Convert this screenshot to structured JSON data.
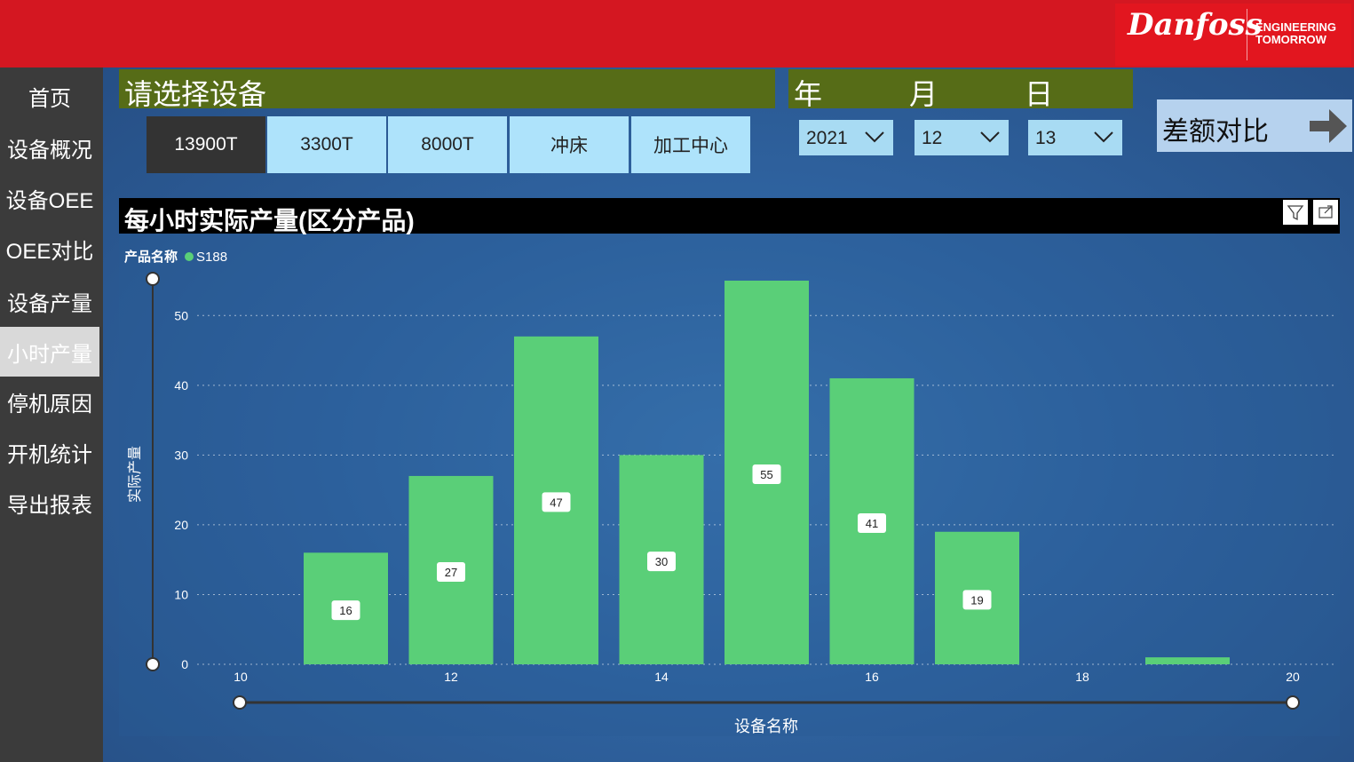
{
  "header": {
    "brand": "Danfoss",
    "tagline_line1": "ENGINEERING",
    "tagline_line2": "TOMORROW"
  },
  "sidebar": {
    "items": [
      {
        "label": "首页"
      },
      {
        "label": "设备概况"
      },
      {
        "label": "设备OEE"
      },
      {
        "label": "OEE对比"
      },
      {
        "label": "设备产量"
      },
      {
        "label": "小时产量",
        "active": true
      },
      {
        "label": "停机原因"
      },
      {
        "label": "开机统计"
      },
      {
        "label": "导出报表"
      }
    ]
  },
  "device_select": {
    "title": "请选择设备",
    "devices": [
      {
        "label": "13900T",
        "selected": true
      },
      {
        "label": "3300T"
      },
      {
        "label": "8000T"
      },
      {
        "label": "冲床"
      },
      {
        "label": "加工中心"
      }
    ]
  },
  "date_select": {
    "year_label": "年",
    "month_label": "月",
    "day_label": "日",
    "year_value": "2021",
    "month_value": "12",
    "day_value": "13"
  },
  "compare_button": {
    "label": "差额对比"
  },
  "colors": {
    "bar": "#5acf78",
    "header_red": "#d41721",
    "olive": "#566c17",
    "sidebar": "#3b3b3b"
  },
  "chart_data": {
    "type": "bar",
    "title": "每小时实际产量(区分产品)",
    "legend_title": "产品名称",
    "series": [
      {
        "name": "S188",
        "points": [
          {
            "x": 11,
            "y": 16,
            "label": "16"
          },
          {
            "x": 12,
            "y": 27,
            "label": "27"
          },
          {
            "x": 13,
            "y": 47,
            "label": "47"
          },
          {
            "x": 14,
            "y": 30,
            "label": "30"
          },
          {
            "x": 15,
            "y": 55,
            "label": "55"
          },
          {
            "x": 16,
            "y": 41,
            "label": "41"
          },
          {
            "x": 17,
            "y": 19,
            "label": "19"
          },
          {
            "x": 19,
            "y": 1
          }
        ]
      }
    ],
    "xlabel": "设备名称",
    "ylabel": "实际产量",
    "xlim": [
      10,
      20
    ],
    "ylim": [
      0,
      55
    ],
    "xticks": [
      "10",
      "12",
      "14",
      "16",
      "18",
      "20"
    ],
    "yticks": [
      "0",
      "10",
      "20",
      "30",
      "40",
      "50"
    ],
    "grid": true,
    "legend_position": "top-left"
  }
}
